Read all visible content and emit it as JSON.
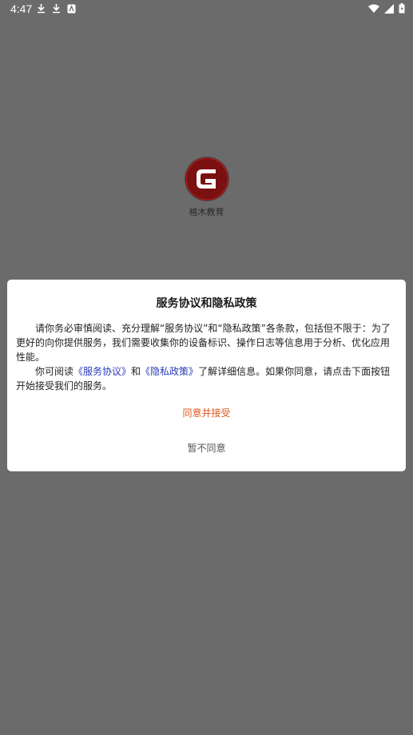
{
  "status_bar": {
    "time": "4:47",
    "left_icons": [
      "download-icon",
      "download-icon",
      "app-notification-icon"
    ],
    "right_icons": [
      "wifi-icon",
      "signal-icon",
      "battery-icon"
    ]
  },
  "app": {
    "name": "格木教育",
    "logo_color": "#6b0f0f"
  },
  "dialog": {
    "title": "服务协议和隐私政策",
    "paragraph1": "请你务必审慎阅读、充分理解“服务协议”和“隐私政策”各条款，包括但不限于：为了更好的向你提供服务，我们需要收集你的设备标识、操作日志等信息用于分析、优化应用性能。",
    "paragraph2_prefix": "你可阅读",
    "service_link": "《服务协议》",
    "and_text": "和",
    "privacy_link": "《隐私政策》",
    "paragraph2_suffix": "了解详细信息。如果你同意，请点击下面按钮开始接受我们的服务。",
    "agree_label": "同意并接受",
    "disagree_label": "暂不同意",
    "agree_color": "#e0571e",
    "link_color": "#2a3bb8"
  }
}
